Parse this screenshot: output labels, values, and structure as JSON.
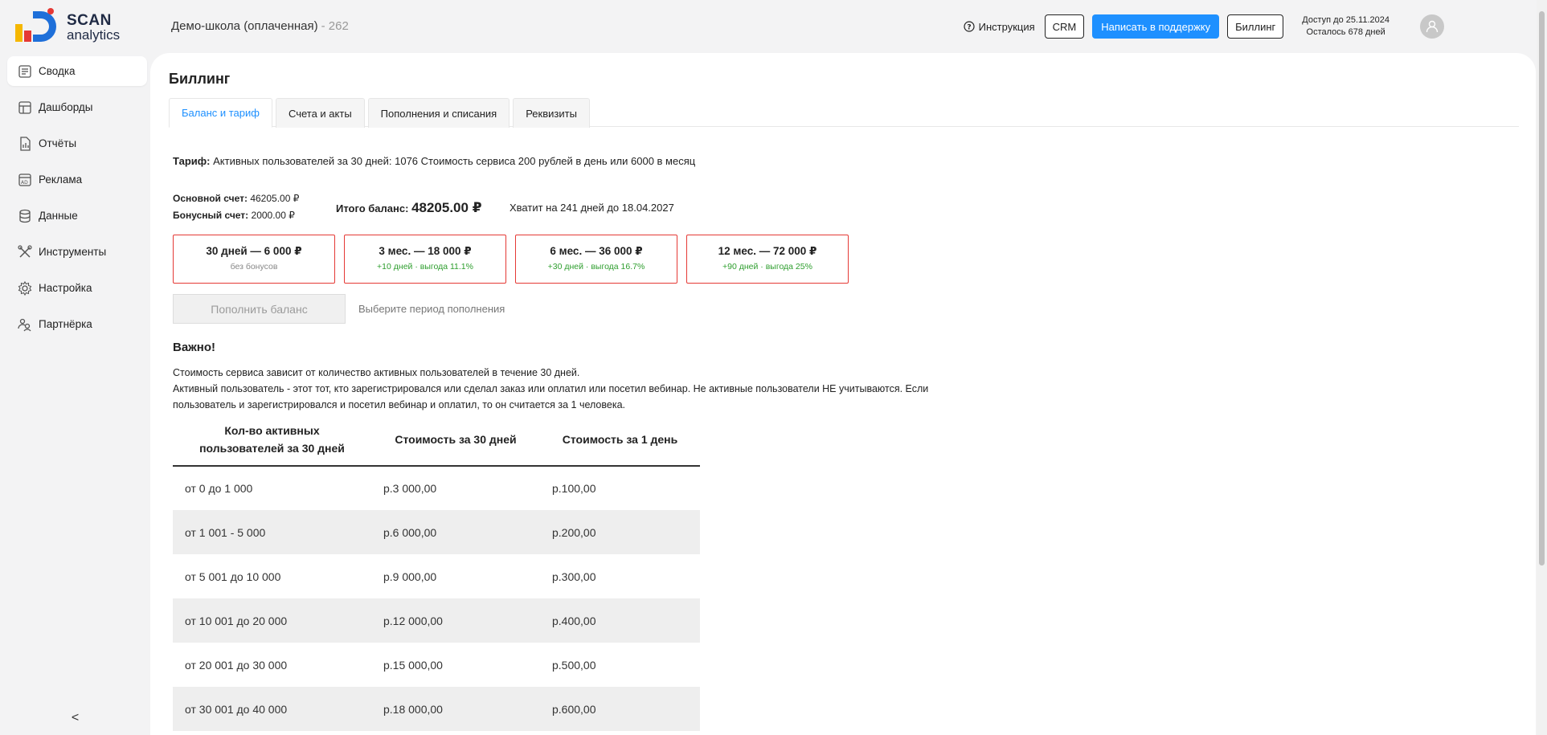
{
  "logo": {
    "line1": "SCAN",
    "line2": "analytics"
  },
  "sidebar": {
    "items": [
      {
        "label": "Сводка",
        "icon": "summary-icon",
        "active": true
      },
      {
        "label": "Дашборды",
        "icon": "dashboard-icon"
      },
      {
        "label": "Отчёты",
        "icon": "reports-icon"
      },
      {
        "label": "Реклама",
        "icon": "ads-icon"
      },
      {
        "label": "Данные",
        "icon": "database-icon"
      },
      {
        "label": "Инструменты",
        "icon": "tools-icon"
      },
      {
        "label": "Настройка",
        "icon": "gear-icon"
      },
      {
        "label": "Партнёрка",
        "icon": "partners-icon"
      }
    ],
    "collapse_glyph": "<"
  },
  "header": {
    "school": "Демо-школа (оплаченная)",
    "school_count": "- 262",
    "instruction": "Инструкция",
    "crm": "CRM",
    "support": "Написать в поддержку",
    "billing": "Биллинг",
    "access_until": "Доступ до 25.11.2024",
    "days_left": "Осталось 678 дней"
  },
  "page": {
    "title": "Биллинг",
    "tabs": [
      "Баланс и тариф",
      "Счета и акты",
      "Пополнения и списания",
      "Реквизиты"
    ],
    "active_tab": 0
  },
  "tariff": {
    "label": "Тариф:",
    "text": "Активных пользователей за 30 дней: 1076 Стоимость сервиса 200 рублей в день или 6000 в месяц"
  },
  "balance": {
    "main_label": "Основной счет:",
    "main_value": "46205.00 ₽",
    "bonus_label": "Бонусный счет:",
    "bonus_value": "2000.00 ₽",
    "total_label": "Итого баланс:",
    "total_value": "48205.00 ₽",
    "enough": "Хватит на 241 дней до 18.04.2027"
  },
  "periods": [
    {
      "title": "30 дней — 6 000 ₽",
      "sub": "без бонусов",
      "sub_muted": true
    },
    {
      "title": "3 мес. — 18 000 ₽",
      "sub": "+10 дней · выгода 11.1%"
    },
    {
      "title": "6 мес. — 36 000 ₽",
      "sub": "+30 дней · выгода 16.7%"
    },
    {
      "title": "12 мес. — 72 000 ₽",
      "sub": "+90 дней · выгода 25%"
    }
  ],
  "topup": {
    "button": "Пополнить баланс",
    "hint": "Выберите период пополнения"
  },
  "important": {
    "title": "Важно!",
    "line1": "Стоимость сервиса зависит от количество активных пользователей в течение 30 дней.",
    "line2": "Активный пользователь - этот тот, кто зарегистрировался или сделал заказ или оплатил или посетил вебинар. Не активные пользователи НЕ учитываются. Если пользователь и зарегистрировался и посетил вебинар и оплатил, то он считается за 1 человека."
  },
  "price_table": {
    "headers": [
      "Кол-во активных пользователей за 30 дней",
      "Стоимость за 30 дней",
      "Стоимость за 1 день"
    ],
    "rows": [
      [
        "от 0 до 1 000",
        "р.3 000,00",
        "р.100,00"
      ],
      [
        "от 1 001 - 5 000",
        "р.6 000,00",
        "р.200,00"
      ],
      [
        "от 5 001 до 10 000",
        "р.9 000,00",
        "р.300,00"
      ],
      [
        "от 10 001 до 20 000",
        "р.12 000,00",
        "р.400,00"
      ],
      [
        "от 20 001 до 30 000",
        "р.15 000,00",
        "р.500,00"
      ],
      [
        "от 30 001 до 40 000",
        "р.18 000,00",
        "р.600,00"
      ]
    ]
  },
  "colors": {
    "accent": "#1e90ff",
    "period_border": "#e53935",
    "bonus_green": "#2e9e2e",
    "logo_blue": "#1e6fd9",
    "logo_red": "#e53935",
    "logo_yellow": "#f5b700"
  }
}
